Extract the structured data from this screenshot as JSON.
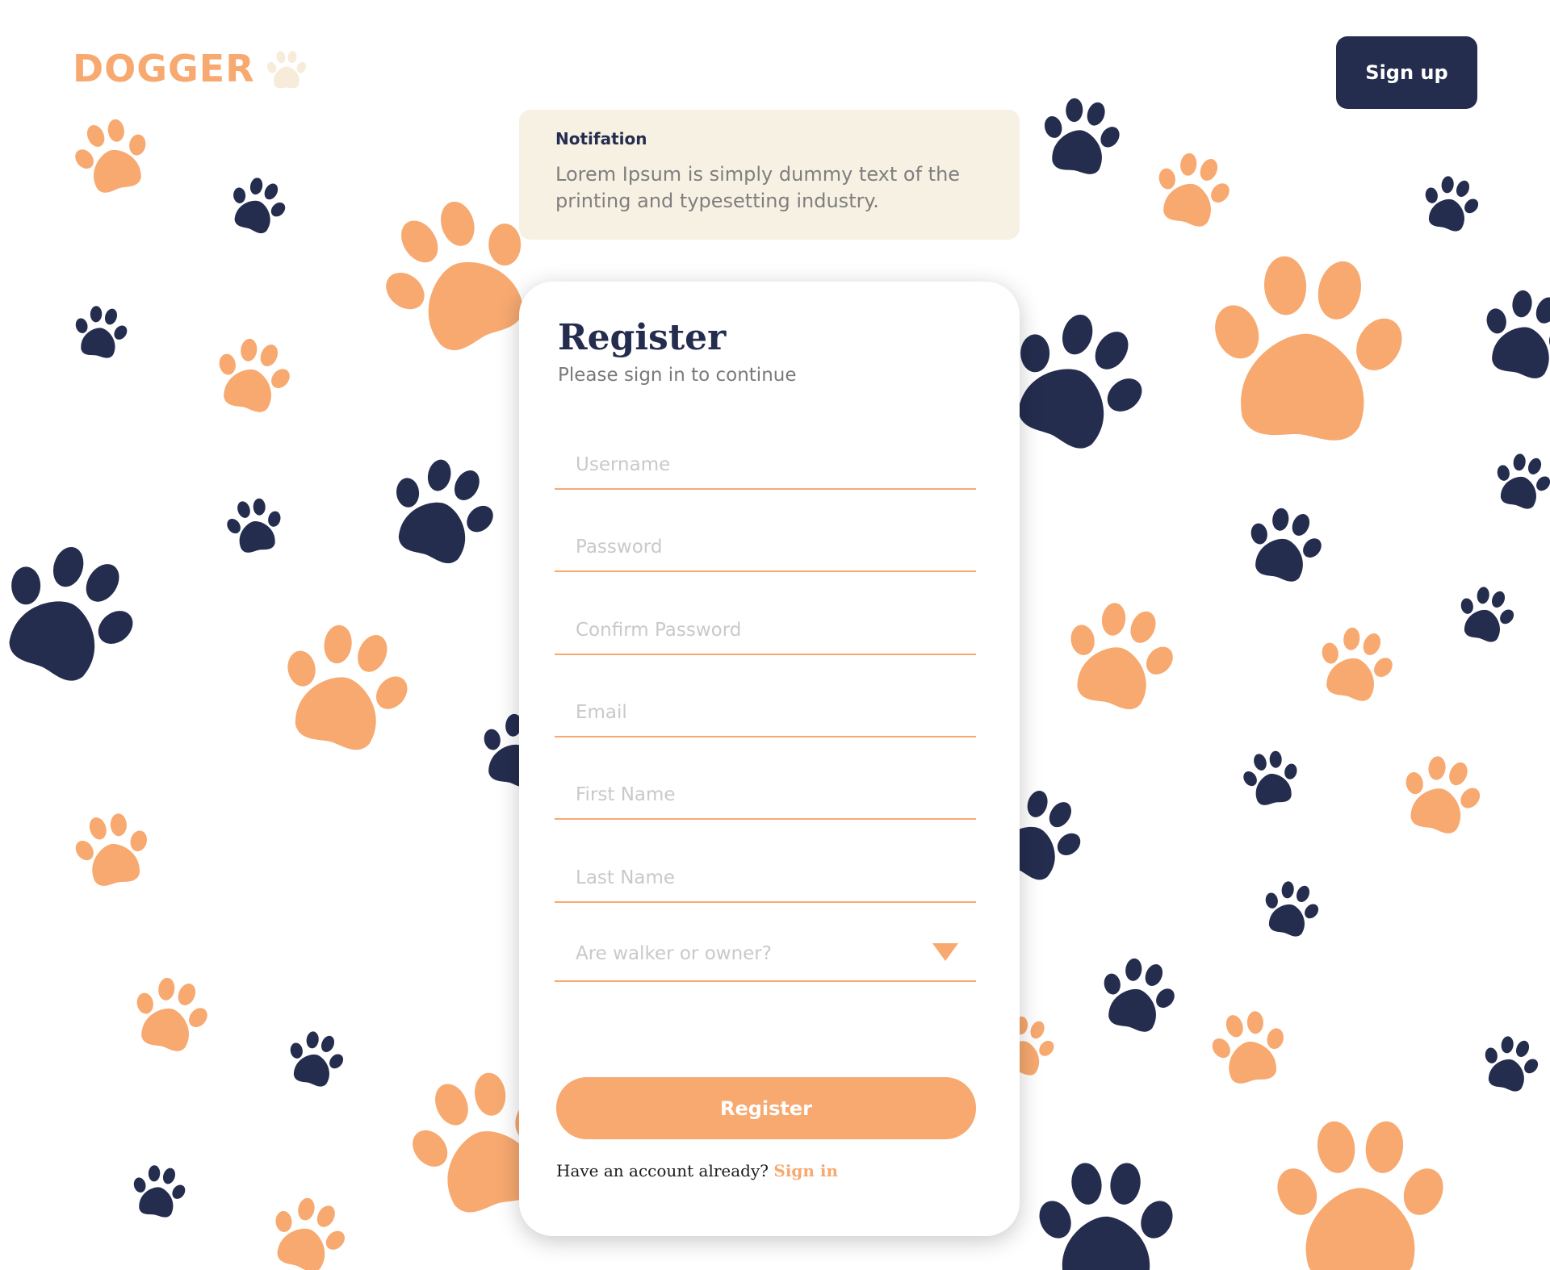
{
  "brand": {
    "name": "DOGGER"
  },
  "header": {
    "signup_label": "Sign up"
  },
  "notification": {
    "title": "Notifation",
    "text": "Lorem Ipsum is simply dummy text of the printing and typesetting industry."
  },
  "register": {
    "title": "Register",
    "subtitle": "Please sign in to continue",
    "fields": {
      "username": "Username",
      "password": "Password",
      "confirm_password": "Confirm Password",
      "email": "Email",
      "first_name": "First Name",
      "last_name": "Last Name"
    },
    "role_select": {
      "placeholder": "Are walker or owner?"
    },
    "submit_label": "Register",
    "have_account": "Have an account already?",
    "signin_label": "Sign in"
  },
  "colors": {
    "orange": "#f7a970",
    "navy": "#252d4f",
    "notification_bg": "#f7f1e4",
    "paw_light": "#f6ecd9"
  },
  "icons": [
    "paw-icon",
    "chevron-down-icon"
  ]
}
